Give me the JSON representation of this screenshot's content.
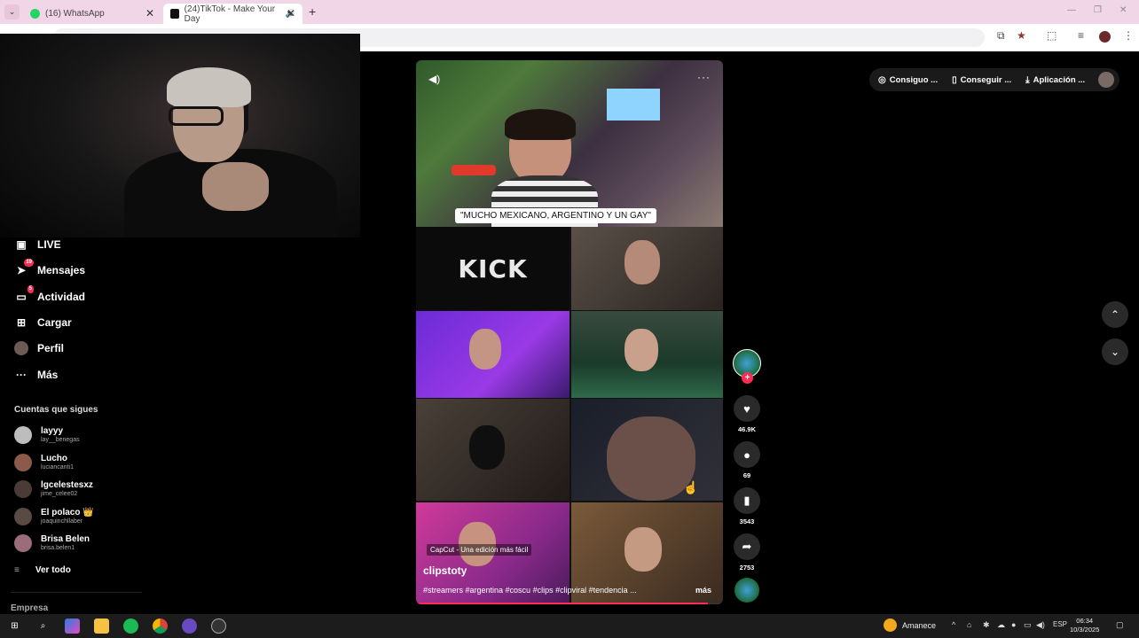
{
  "browser": {
    "tabs": [
      {
        "title": "(16) WhatsApp",
        "icon": "whatsapp-icon",
        "active": false
      },
      {
        "title": "(24)TikTok - Make Your Day",
        "icon": "tiktok-icon",
        "active": true
      }
    ]
  },
  "sidebar": {
    "nav": [
      {
        "label": "LIVE",
        "icon": "live-icon"
      },
      {
        "label": "Mensajes",
        "icon": "messages-icon",
        "badge": "19"
      },
      {
        "label": "Actividad",
        "icon": "activity-icon",
        "badge": "5"
      },
      {
        "label": "Cargar",
        "icon": "upload-icon"
      },
      {
        "label": "Perfil",
        "icon": "profile-icon"
      },
      {
        "label": "Más",
        "icon": "more-icon"
      }
    ],
    "following_title": "Cuentas que sigues",
    "following": [
      {
        "name": "layyy",
        "username": "lay__benegas"
      },
      {
        "name": "Lucho",
        "username": "luciancanti1"
      },
      {
        "name": "lgcelestesxz",
        "username": "jime_celee02"
      },
      {
        "name": "El polaco 👑",
        "username": "joaquinchllaber"
      },
      {
        "name": "Brisa Belen",
        "username": "brisa.belen1"
      }
    ],
    "see_all": "Ver todo",
    "footer": "Empresa"
  },
  "topbar": {
    "buttons": [
      {
        "label": "Consiguo ...",
        "icon": "coin-icon"
      },
      {
        "label": "Conseguir ...",
        "icon": "phone-icon"
      },
      {
        "label": "Aplicación ...",
        "icon": "download-icon"
      }
    ]
  },
  "video": {
    "subtitle": "\"MUCHO MEXICANO, ARGENTINO Y UN GAY\"",
    "kick_logo": "KICK",
    "capcut": "CapCut - Una edición más fácil",
    "author": "clipstoty",
    "description": "#streamers #argentina #coscu #clips #clipviral #tendencia ...",
    "more": "más",
    "progress": 0.95
  },
  "actions": {
    "likes": "46.9K",
    "comments": "69",
    "saves": "3543",
    "shares": "2753"
  },
  "taskbar": {
    "weather": "Amanece",
    "lang": "ESP",
    "time": "06:34",
    "date": "10/3/2025"
  }
}
